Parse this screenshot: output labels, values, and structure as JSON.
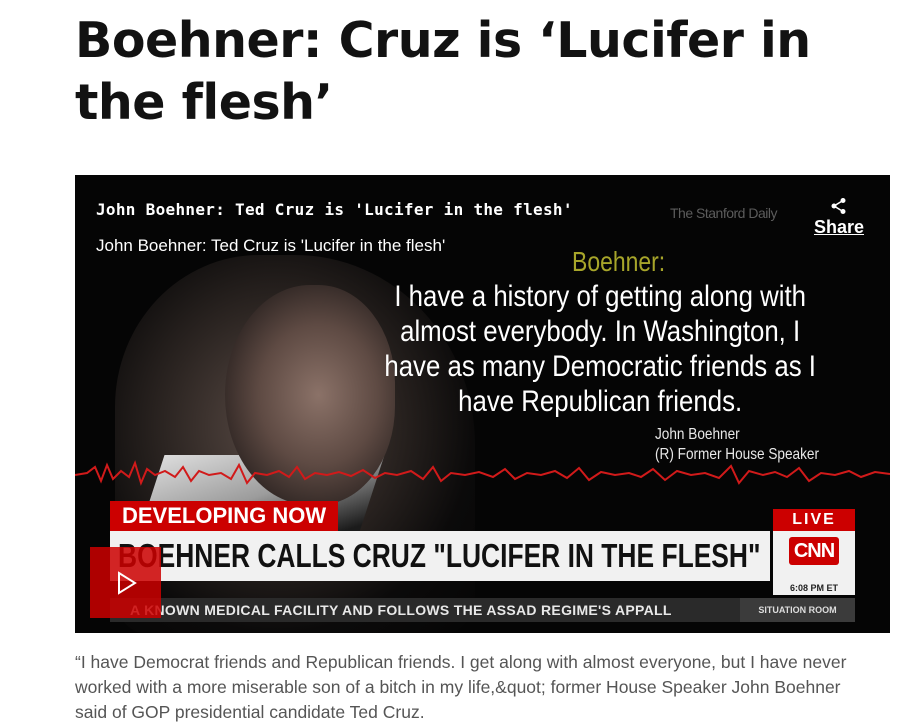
{
  "article": {
    "headline": "Boehner: Cruz is ‘Lucifer in the flesh’",
    "caption": "“I have Democrat friends and Republican friends. I get along with almost everyone, but I have never worked with a more miserable son of a bitch in my life,&quot; former House Speaker John Boehner said of GOP presidential candidate Ted Cruz."
  },
  "video": {
    "title": "John Boehner: Ted Cruz is 'Lucifer in the flesh'",
    "subtitle": "John Boehner: Ted Cruz is 'Lucifer in the flesh'",
    "watermark": "The Stanford Daily",
    "share_label": "Share",
    "share_icon": "share-icon",
    "play_icon": "play-icon",
    "quote": {
      "speaker": "Boehner:",
      "text": "I have a history of getting along with almost everybody. In Washington, I have as many Democratic friends as I have Republican friends.",
      "attribution_name": "John Boehner",
      "attribution_title": "(R) Former House Speaker"
    },
    "lower_third": {
      "developing": "DEVELOPING NOW",
      "live": "LIVE",
      "banner": "BOEHNER CALLS CRUZ \"LUCIFER IN THE FLESH\"",
      "logo": "CNN",
      "time": "6:08 PM ET",
      "ticker": "A KNOWN MEDICAL FACILITY AND FOLLOWS THE ASSAD REGIME'S APPALL",
      "show": "SITUATION ROOM"
    }
  },
  "colors": {
    "accent_red": "#cc0000",
    "speaker_gold": "#a7a52a",
    "caption_gray": "#555555"
  }
}
